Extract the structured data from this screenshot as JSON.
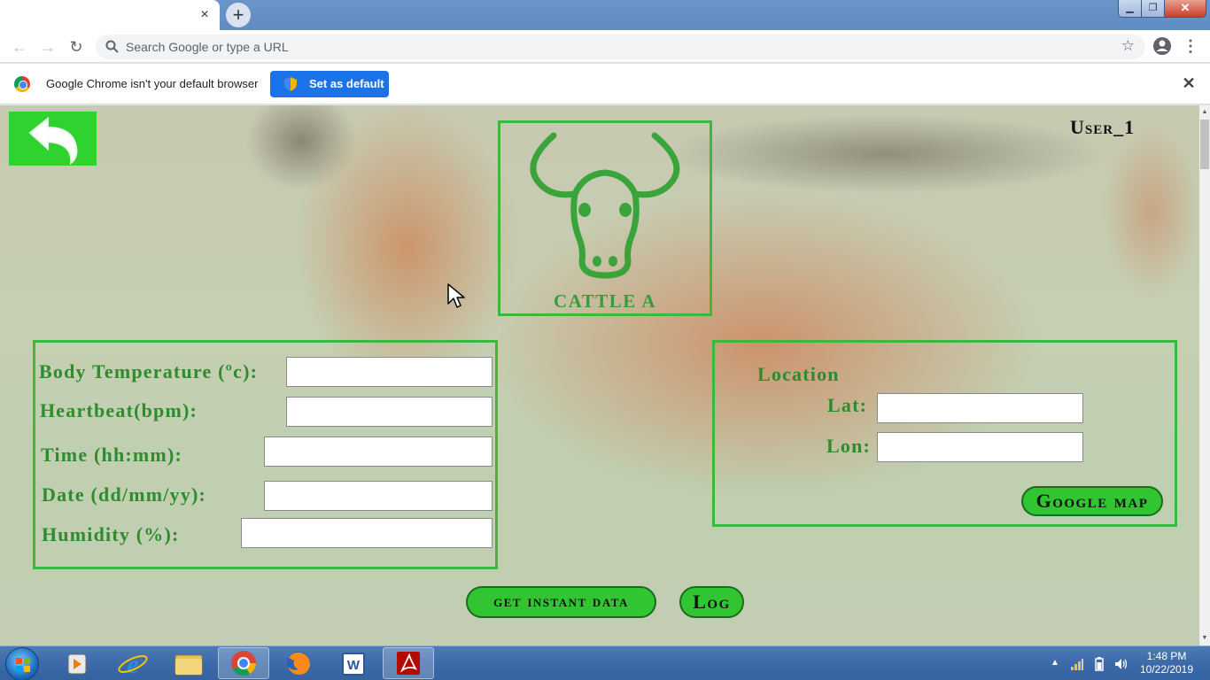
{
  "browser": {
    "tab_close": "×",
    "new_tab": "+",
    "window_buttons": {
      "minimize": "▁",
      "maximize": "❐",
      "close": "✕"
    },
    "omnibox_placeholder": "Search Google or type a URL",
    "infobar": {
      "message": "Google Chrome isn't your default browser",
      "set_default_label": "Set as default",
      "close": "✕"
    }
  },
  "page": {
    "user_label": "User_1",
    "cattle_label": "CATTLE A",
    "sensors": {
      "body_temp_label": "Body Temperature (ºc):",
      "heartbeat_label": "Heartbeat(bpm):",
      "time_label": "Time (hh:mm):",
      "date_label": "Date (dd/mm/yy):",
      "humidity_label": "Humidity (%):",
      "body_temp_value": "",
      "heartbeat_value": "",
      "time_value": "",
      "date_value": "",
      "humidity_value": ""
    },
    "location": {
      "title": "Location",
      "lat_label": "Lat:",
      "lon_label": "Lon:",
      "lat_value": "",
      "lon_value": "",
      "map_button": "Google map"
    },
    "instant_button": "get instant data",
    "log_button": "Log"
  },
  "taskbar": {
    "time": "1:48 PM",
    "date": "10/22/2019"
  },
  "colors": {
    "accent_green": "#3cb83c",
    "button_green": "#31c631",
    "label_green": "#2e8b2e",
    "chrome_blue": "#1a73e8"
  }
}
